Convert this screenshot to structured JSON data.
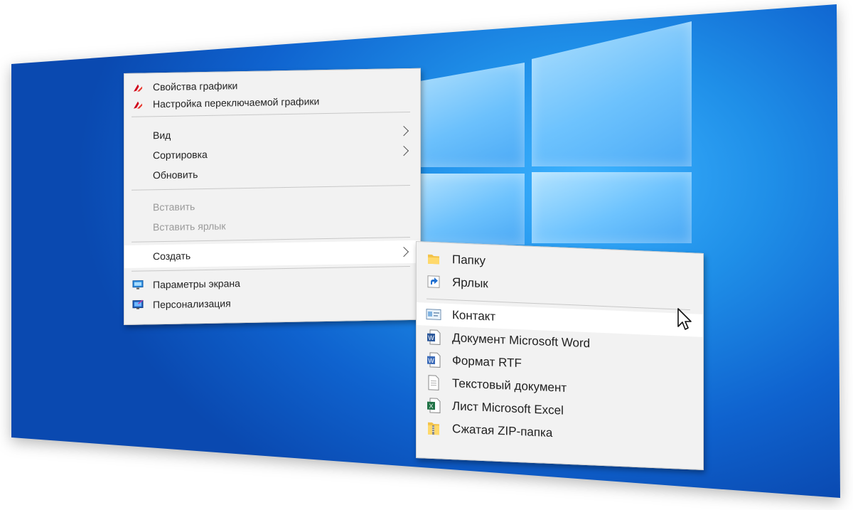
{
  "main_menu": {
    "items": [
      {
        "label": "Свойства графики",
        "icon": "amd-radeon-icon"
      },
      {
        "label": "Настройка переключаемой графики",
        "icon": "amd-radeon-icon"
      },
      {
        "label": "Вид",
        "submenu": true
      },
      {
        "label": "Сортировка",
        "submenu": true
      },
      {
        "label": "Обновить"
      },
      {
        "label": "Вставить",
        "disabled": true
      },
      {
        "label": "Вставить ярлык",
        "disabled": true
      },
      {
        "label": "Создать",
        "submenu": true,
        "highlighted": true
      },
      {
        "label": "Параметры экрана",
        "icon": "display-settings-icon"
      },
      {
        "label": "Персонализация",
        "icon": "personalize-icon"
      }
    ]
  },
  "create_submenu": {
    "items": [
      {
        "label": "Папку",
        "icon": "folder-icon"
      },
      {
        "label": "Ярлык",
        "icon": "shortcut-icon"
      },
      {
        "label": "Контакт",
        "icon": "contact-card-icon",
        "highlighted": true
      },
      {
        "label": "Документ Microsoft Word",
        "icon": "word-document-icon"
      },
      {
        "label": "Формат RTF",
        "icon": "rtf-document-icon"
      },
      {
        "label": "Текстовый документ",
        "icon": "text-document-icon"
      },
      {
        "label": "Лист Microsoft Excel",
        "icon": "excel-sheet-icon"
      },
      {
        "label": "Сжатая ZIP-папка",
        "icon": "zip-folder-icon"
      }
    ]
  },
  "colors": {
    "desktop_blue": "#1f8fe8",
    "menu_bg": "#f2f2f2",
    "highlight_bg": "#ffffff",
    "disabled_text": "#9a9a9a",
    "amd_red": "#d0021b"
  }
}
